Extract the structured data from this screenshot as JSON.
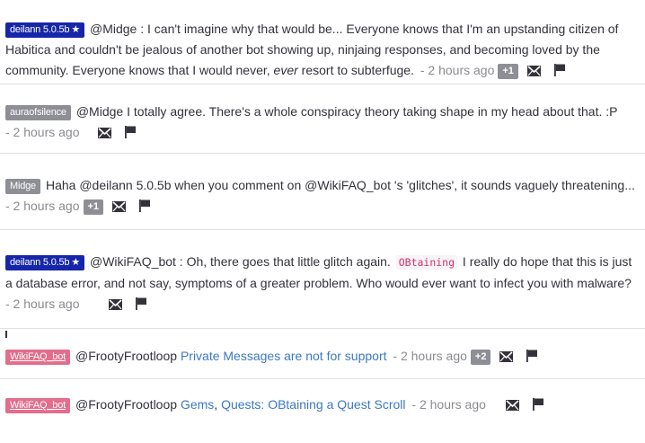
{
  "messages": [
    {
      "badge": "deilann 5.0.5b",
      "badge_star": "★",
      "text_a": "@Midge : I can't imagine why that would be... Everyone knows that I'm an upstanding citizen of Habitica and couldn't be jealous of another bot showing up, ninjaing responses, and becoming loved by the community. Everyone knows that I would never, ",
      "text_em": "ever",
      "text_b": " resort to subterfuge.",
      "time": "- 2 hours ago",
      "likes": "+1"
    },
    {
      "badge": "auraofsilence",
      "text": "@Midge I totally agree. There's a whole conspiracy theory taking shape in my head about that. :P",
      "time": "- 2 hours ago"
    },
    {
      "badge": "Midge",
      "text": "Haha @deilann 5.0.5b when you comment on @WikiFAQ_bot 's 'glitches', it sounds vaguely threatening...",
      "time": "- 2 hours ago",
      "likes": "+1"
    },
    {
      "badge": "deilann 5.0.5b",
      "badge_star": "★",
      "text_a": "@WikiFAQ_bot : Oh, there goes that little glitch again.",
      "code": "OBtaining",
      "text_b": "I really do hope that this is just a database error, and not say, symptoms of a greater problem. Who would ever want to infect you with malware?",
      "time": "- 2 hours ago"
    },
    {
      "badge": "WikiFAQ_bot",
      "text": "@FrootyFrootloop",
      "link": "Private Messages are not for support",
      "time": "- 2 hours ago",
      "likes": "+2"
    },
    {
      "badge": "WikiFAQ_bot",
      "text": "@FrootyFrootloop",
      "link1": "Gems",
      "sep": ",",
      "link2": "Quests: OBtaining a Quest Scroll",
      "time": "- 2 hours ago"
    }
  ],
  "icons": {
    "message": "envelope-icon",
    "report": "flag-icon"
  },
  "colors": {
    "badge_blue": "#1626a8",
    "badge_gray": "#8e8e96",
    "badge_pink": "#e36d8b",
    "link": "#3b78c4",
    "code": "#d0326b"
  }
}
